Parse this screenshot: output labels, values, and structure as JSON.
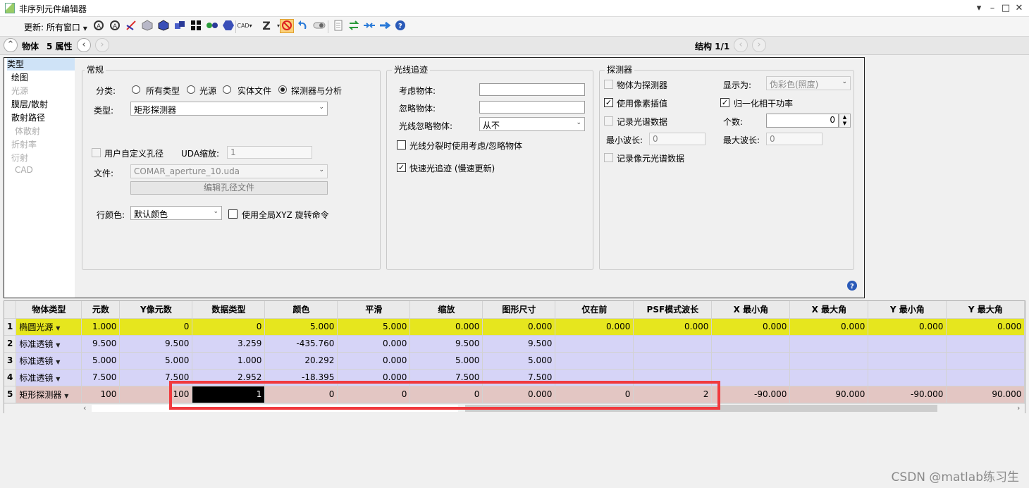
{
  "window": {
    "title": "非序列元件编辑器",
    "controls": [
      "▾",
      "–",
      "□",
      "✕"
    ]
  },
  "toolbar": {
    "update_label": "更新: 所有窗口",
    "icons": [
      "refresh-all",
      "refresh",
      "ray-trace",
      "cube-grey",
      "cube-blue",
      "cubes",
      "grid",
      "dots",
      "hexagon",
      "cad",
      "z-sort",
      "stop",
      "undo",
      "toggle",
      "doc",
      "swap",
      "arrows",
      "arrow-right",
      "help"
    ],
    "cad_label": "CAD",
    "z_label": "Z"
  },
  "nav": {
    "object_label": "物体",
    "property_label": "5 属性",
    "structure_label": "结构 1/1"
  },
  "sidebar": {
    "items": [
      {
        "label": "类型",
        "state": "selected"
      },
      {
        "label": "绘图",
        "state": "normal"
      },
      {
        "label": "光源",
        "state": "disabled"
      },
      {
        "label": "膜层/散射",
        "state": "normal"
      },
      {
        "label": "散射路径",
        "state": "normal"
      },
      {
        "label": "体散射",
        "state": "disabled"
      },
      {
        "label": "折射率",
        "state": "disabled"
      },
      {
        "label": "衍射",
        "state": "disabled"
      },
      {
        "label": "CAD",
        "state": "disabled"
      }
    ]
  },
  "general": {
    "title": "常规",
    "category_label": "分类:",
    "radios": [
      {
        "label": "所有类型",
        "checked": false
      },
      {
        "label": "光源",
        "checked": false
      },
      {
        "label": "实体文件",
        "checked": false
      },
      {
        "label": "探测器与分析",
        "checked": true
      }
    ],
    "type_label": "类型:",
    "type_value": "矩形探测器",
    "custom_aperture_label": "用户自定义孔径",
    "uda_scale_label": "UDA缩放:",
    "uda_scale_value": "1",
    "file_label": "文件:",
    "file_value": "COMAR_aperture_10.uda",
    "edit_aperture_label": "编辑孔径文件",
    "row_color_label": "行颜色:",
    "row_color_value": "默认颜色",
    "global_xyz_label": "使用全局XYZ 旋转命令"
  },
  "raytrace": {
    "title": "光线追迹",
    "consider_label": "考虑物体:",
    "consider_value": "",
    "ignore_label": "忽略物体:",
    "ignore_value": "",
    "ray_ignore_label": "光线忽略物体:",
    "ray_ignore_value": "从不",
    "split_label": "光线分裂时使用考虑/忽略物体",
    "split_checked": false,
    "fast_label": "快速光追迹 (慢速更新)",
    "fast_checked": true
  },
  "detector": {
    "title": "探测器",
    "as_detector_label": "物体为探测器",
    "display_label": "显示为:",
    "display_value": "伪彩色(照度)",
    "pixel_interp_label": "使用像素插值",
    "pixel_interp_checked": true,
    "normalize_label": "归一化相干功率",
    "normalize_checked": true,
    "record_spectrum_label": "记录光谱数据",
    "count_label": "个数:",
    "count_value": "0",
    "min_wl_label": "最小波长:",
    "min_wl_value": "0",
    "max_wl_label": "最大波长:",
    "max_wl_value": "0",
    "record_pixel_spectrum_label": "记录像元光谱数据"
  },
  "grid": {
    "headers": [
      "",
      "物体类型",
      "元数",
      "Y像元数",
      "数据类型",
      "颜色",
      "平滑",
      "缩放",
      "图形尺寸",
      "仅在前",
      "PSF模式波长",
      "X 最小角",
      "X 最大角",
      "Y 最小角",
      "Y 最大角"
    ],
    "rows": [
      {
        "num": "1",
        "type": "椭圆光源",
        "cells": [
          "1.000",
          "0",
          "0",
          "5.000",
          "5.000",
          "0.000",
          "0.000",
          "0.000",
          "0.000",
          "0.000",
          "0.000",
          "0.000",
          "0.000"
        ]
      },
      {
        "num": "2",
        "type": "标准透镜",
        "cells": [
          "9.500",
          "9.500",
          "3.259",
          "-435.760",
          "0.000",
          "9.500",
          "9.500",
          "",
          "",
          "",
          "",
          "",
          ""
        ]
      },
      {
        "num": "3",
        "type": "标准透镜",
        "cells": [
          "5.000",
          "5.000",
          "1.000",
          "20.292",
          "0.000",
          "5.000",
          "5.000",
          "",
          "",
          "",
          "",
          "",
          ""
        ]
      },
      {
        "num": "4",
        "type": "标准透镜",
        "cells": [
          "7.500",
          "7.500",
          "2.952",
          "-18.395",
          "0.000",
          "7.500",
          "7.500",
          "",
          "",
          "",
          "",
          "",
          ""
        ]
      },
      {
        "num": "5",
        "type": "矩形探测器",
        "cells": [
          "100",
          "100",
          "1",
          "0",
          "0",
          "0",
          "0.000",
          "0",
          "2",
          "-90.000",
          "90.000",
          "-90.000",
          "90.000"
        ]
      }
    ]
  },
  "watermark": "CSDN @matlab练习生"
}
